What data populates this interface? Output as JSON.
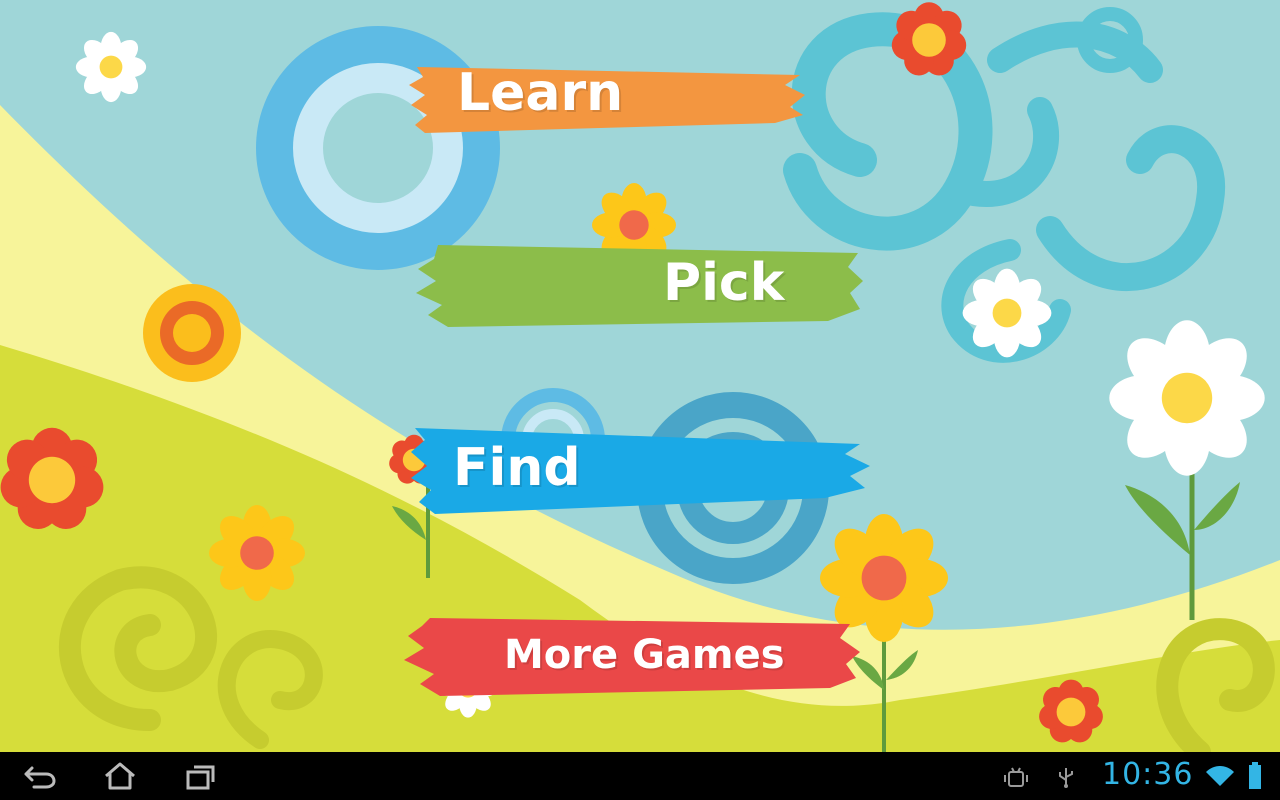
{
  "menu": {
    "learn": {
      "label": "Learn",
      "color": "#f39640"
    },
    "pick": {
      "label": "Pick",
      "color": "#8cbd4a"
    },
    "find": {
      "label": "Find",
      "color": "#1aa9e6"
    },
    "more_games": {
      "label": "More Games",
      "color": "#ea4848"
    }
  },
  "status_bar": {
    "time": "10:36",
    "icons": [
      "android-debug-icon",
      "usb-icon",
      "wifi-icon",
      "battery-icon"
    ],
    "accent": "#33b5e5"
  },
  "nav_bar": {
    "icons": [
      "back-icon",
      "home-icon",
      "recent-apps-icon"
    ]
  },
  "colors": {
    "sky": "#9fd6d8",
    "hill_light": "#f7f49a",
    "hill_green": "#d6dd3a"
  }
}
